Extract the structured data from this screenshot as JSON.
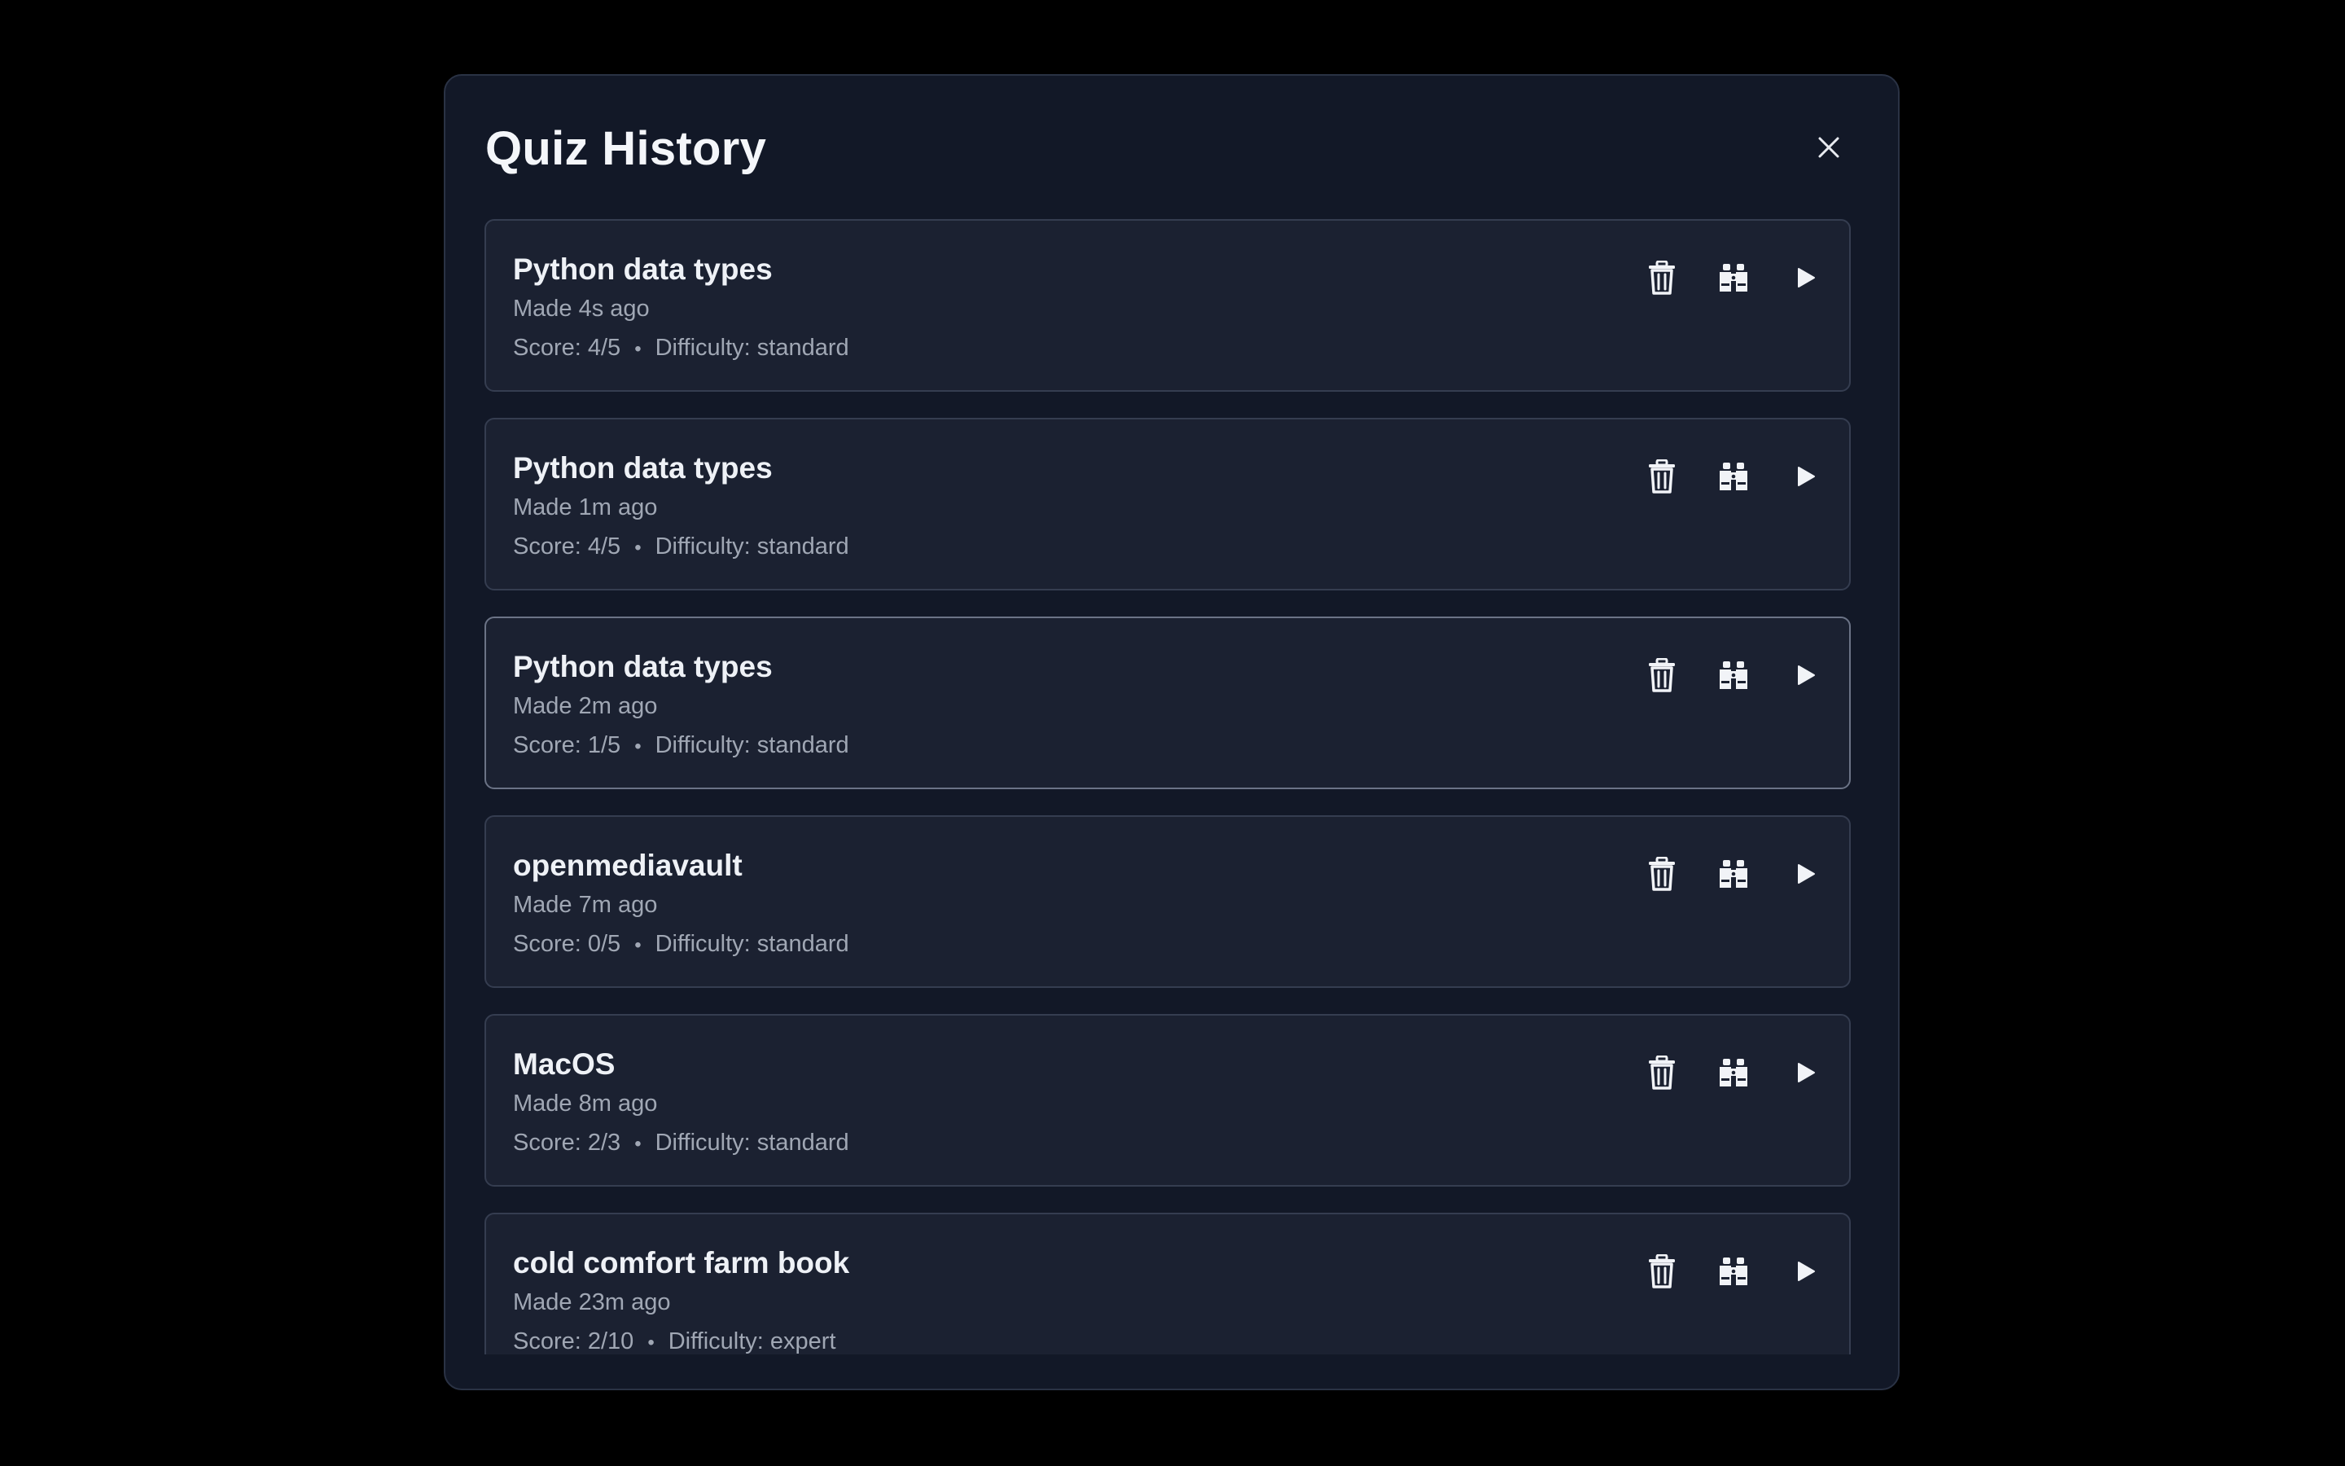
{
  "modal": {
    "title": "Quiz History",
    "close_icon": "close-icon"
  },
  "icons": {
    "delete": "trash-icon",
    "review": "binoculars-icon",
    "retake": "play-icon"
  },
  "colors": {
    "background": "#000000",
    "modal_bg": "#121827",
    "card_bg": "#1b2131",
    "card_border": "#353d50",
    "card_border_highlight": "#6b7386",
    "text_primary": "#eef1f6",
    "text_secondary": "#a0a7b4"
  },
  "quizzes": [
    {
      "title": "Python data types",
      "made": "Made 4s ago",
      "score": "Score: 4/5",
      "separator": "•",
      "difficulty": "Difficulty: standard",
      "highlighted": false
    },
    {
      "title": "Python data types",
      "made": "Made 1m ago",
      "score": "Score: 4/5",
      "separator": "•",
      "difficulty": "Difficulty: standard",
      "highlighted": false
    },
    {
      "title": "Python data types",
      "made": "Made 2m ago",
      "score": "Score: 1/5",
      "separator": "•",
      "difficulty": "Difficulty: standard",
      "highlighted": true
    },
    {
      "title": "openmediavault",
      "made": "Made 7m ago",
      "score": "Score: 0/5",
      "separator": "•",
      "difficulty": "Difficulty: standard",
      "highlighted": false
    },
    {
      "title": "MacOS",
      "made": "Made 8m ago",
      "score": "Score: 2/3",
      "separator": "•",
      "difficulty": "Difficulty: standard",
      "highlighted": false
    },
    {
      "title": "cold comfort farm book",
      "made": "Made 23m ago",
      "score": "Score: 2/10",
      "separator": "•",
      "difficulty": "Difficulty: expert",
      "highlighted": false
    }
  ]
}
